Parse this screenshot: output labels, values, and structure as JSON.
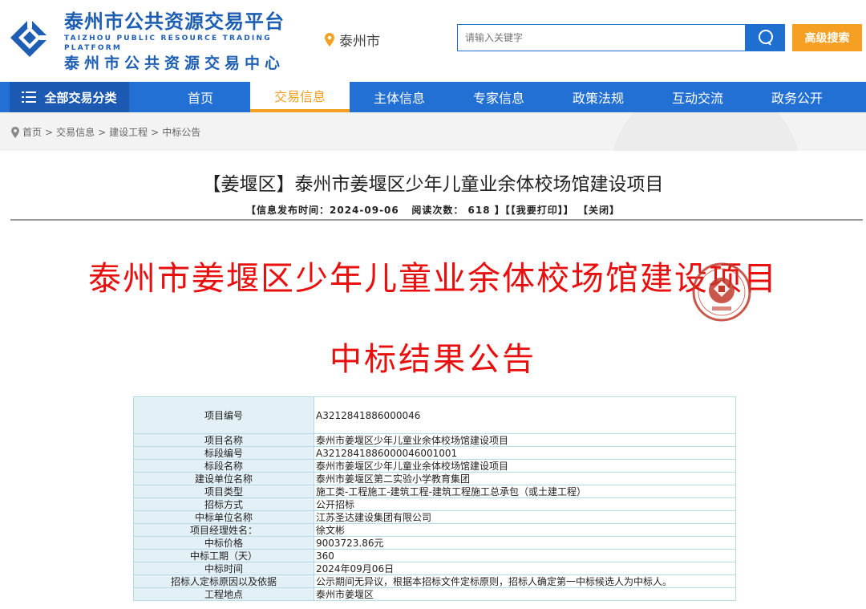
{
  "header": {
    "logo_cn_main": "泰州市公共资源交易平台",
    "logo_en": "TAIZHOU PUBLIC RESOURCE TRADING PLATFORM",
    "logo_cn_sub": "泰州市公共资源交易中心",
    "city": "泰州市",
    "search_placeholder": "请输入关键字",
    "advanced_search": "高级搜索"
  },
  "nav": {
    "all_categories": "全部交易分类",
    "items": [
      "首页",
      "交易信息",
      "主体信息",
      "专家信息",
      "政策法规",
      "互动交流",
      "政务公开"
    ],
    "active": "交易信息"
  },
  "breadcrumb": [
    "首页",
    "交易信息",
    "建设工程",
    "中标公告"
  ],
  "article": {
    "title": "【姜堰区】泰州市姜堰区少年儿童业余体校场馆建设项目",
    "meta_publish": "【信息发布时间：2024-09-06",
    "meta_reads": "阅读次数：",
    "meta_reads_count": "618",
    "meta_print": "】【【我要打印】】",
    "meta_close": "【关闭】",
    "heading_project": "泰州市姜堰区少年儿童业余体校场馆建设项目",
    "heading_notice": "中标结果公告"
  },
  "colors": {
    "brand_blue": "#1e6fd0",
    "nav_blue": "#2370d4",
    "accent_orange": "#f5a023",
    "heading_red": "#e8100f",
    "seal_red": "#c0392b"
  },
  "info_table": [
    {
      "k": "项目编号",
      "v": "A3212841886000046"
    },
    {
      "k": "项目名称",
      "v": "泰州市姜堰区少年儿童业余体校场馆建设项目"
    },
    {
      "k": "标段编号",
      "v": "A3212841886000046001001"
    },
    {
      "k": "标段名称",
      "v": "泰州市姜堰区少年儿童业余体校场馆建设项目"
    },
    {
      "k": "建设单位名称",
      "v": "泰州市姜堰区第二实验小学教育集团"
    },
    {
      "k": "项目类型",
      "v": "施工类-工程施工-建筑工程-建筑工程施工总承包（或土建工程）"
    },
    {
      "k": "招标方式",
      "v": "公开招标"
    },
    {
      "k": "中标单位名称",
      "v": "江苏圣达建设集团有限公司"
    },
    {
      "k": "项目经理姓名：",
      "v": "徐文彬"
    },
    {
      "k": "中标价格",
      "v": "9003723.86元"
    },
    {
      "k": "中标工期（天）",
      "v": "360"
    },
    {
      "k": "中标时间",
      "v": "2024年09月06日"
    },
    {
      "k": "招标人定标原因以及依据",
      "v": "公示期间无异议，根据本招标文件定标原则，招标人确定第一中标候选人为中标人。"
    },
    {
      "k": "工程地点",
      "v": "泰州市姜堰区"
    }
  ]
}
